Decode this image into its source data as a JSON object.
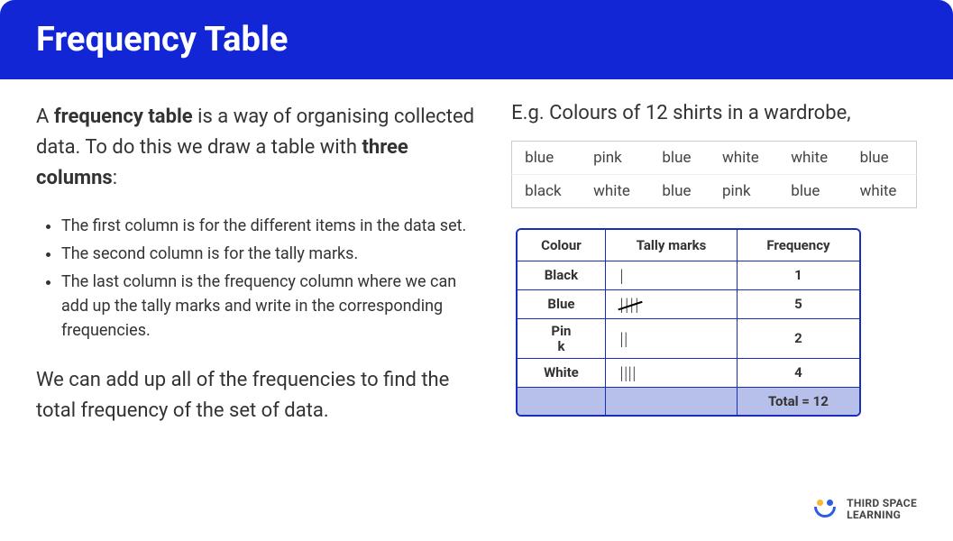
{
  "header": {
    "title": "Frequency Table"
  },
  "intro": {
    "part1": "A ",
    "bold1": "frequency table",
    "part2": " is a way of organising collected data. To do this we draw a table with ",
    "bold2": "three columns",
    "part3": ":"
  },
  "bullets": [
    "The first column is for the different items in the data set.",
    "The second column is for the tally marks.",
    "The last column is the frequency column where we can add up the tally marks and write in the corresponding frequencies."
  ],
  "outro": "We can add up all of the frequencies to find the total frequency of the set of data.",
  "example": {
    "title": "E.g. Colours of 12 shirts in a wardrobe,",
    "raw": [
      [
        "blue",
        "pink",
        "blue",
        "white",
        "white",
        "blue"
      ],
      [
        "black",
        "white",
        "blue",
        "pink",
        "blue",
        "white"
      ]
    ],
    "freq_headers": [
      "Colour",
      "Tally marks",
      "Frequency"
    ],
    "freq_rows": [
      {
        "label": "Black",
        "tally": "|",
        "freq": "1"
      },
      {
        "label": "Blue",
        "tally": "5",
        "freq": "5"
      },
      {
        "label": "Pink",
        "tally": "||",
        "freq": "2"
      },
      {
        "label": "White",
        "tally": "||||",
        "freq": "4"
      }
    ],
    "total_label": "Total = 12"
  },
  "brand": {
    "line1": "THIRD SPACE",
    "line2": "LEARNING"
  }
}
